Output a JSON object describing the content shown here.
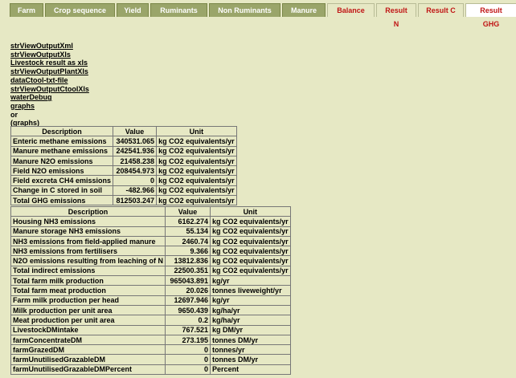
{
  "tabs": [
    {
      "label": "Farm",
      "style": "normal"
    },
    {
      "label": "Crop sequence",
      "style": "normal"
    },
    {
      "label": "Yield",
      "style": "normal"
    },
    {
      "label": "Ruminants",
      "style": "normal"
    },
    {
      "label": "Non Ruminants",
      "style": "normal"
    },
    {
      "label": "Manure",
      "style": "normal"
    },
    {
      "label": "Balance",
      "style": "alt"
    },
    {
      "label": "Result N",
      "style": "alt"
    },
    {
      "label": "Result C",
      "style": "alt"
    },
    {
      "label": "Result GHG",
      "style": "active"
    }
  ],
  "links": [
    "strViewOutputXml",
    "strViewOutputXls",
    "Livestock result as xls",
    "strViewOutputPlantXls",
    "dataCtool-txt-file",
    "strViewOutputCtoolXls",
    "waterDebug",
    "graphs"
  ],
  "or_text": "or",
  "graphs_paren": "(graphs)",
  "table1": {
    "headers": [
      "Description",
      "Value",
      "Unit"
    ],
    "rows": [
      [
        "Enteric methane emissions",
        "340531.065",
        "kg CO2 equivalents/yr"
      ],
      [
        "Manure methane emissions",
        "242541.936",
        "kg CO2 equivalents/yr"
      ],
      [
        "Manure N2O emissions",
        "21458.238",
        "kg CO2 equivalents/yr"
      ],
      [
        "Field N2O emissions",
        "208454.973",
        "kg CO2 equivalents/yr"
      ],
      [
        "Field excreta CH4 emissions",
        "0",
        "kg CO2 equivalents/yr"
      ],
      [
        "Change in C stored in soil",
        "-482.966",
        "kg CO2 equivalents/yr"
      ],
      [
        "Total GHG emissions",
        "812503.247",
        "kg CO2 equivalents/yr"
      ]
    ]
  },
  "table2": {
    "headers": [
      "Description",
      "Value",
      "Unit"
    ],
    "rows": [
      [
        "Housing NH3 emissions",
        "6162.274",
        "kg CO2 equivalents/yr"
      ],
      [
        "Manure storage NH3 emissions",
        "55.134",
        "kg CO2 equivalents/yr"
      ],
      [
        "NH3 emissions from field-applied manure",
        "2460.74",
        "kg CO2 equivalents/yr"
      ],
      [
        "NH3 emissions from fertilisers",
        "9.366",
        "kg CO2 equivalents/yr"
      ],
      [
        "N2O emissions resulting from leaching of N",
        "13812.836",
        "kg CO2 equivalents/yr"
      ],
      [
        "Total indirect emissions",
        "22500.351",
        "kg CO2 equivalents/yr"
      ],
      [
        "Total farm milk production",
        "965043.891",
        "kg/yr"
      ],
      [
        "Total farm meat production",
        "20.026",
        "tonnes liveweight/yr"
      ],
      [
        "Farm milk production per head",
        "12697.946",
        "kg/yr"
      ],
      [
        "Milk production per unit area",
        "9650.439",
        "kg/ha/yr"
      ],
      [
        "Meat production per unit area",
        "0.2",
        "kg/ha/yr"
      ],
      [
        "LivestockDMintake",
        "767.521",
        "kg DM/yr"
      ],
      [
        "farmConcentrateDM",
        "273.195",
        "tonnes DM/yr"
      ],
      [
        "farmGrazedDM",
        "0",
        "tonnes/yr"
      ],
      [
        "farmUnutilisedGrazableDM",
        "0",
        "tonnes DM/yr"
      ],
      [
        "farmUnutilisedGrazableDMPercent",
        "0",
        "Percent"
      ]
    ]
  }
}
